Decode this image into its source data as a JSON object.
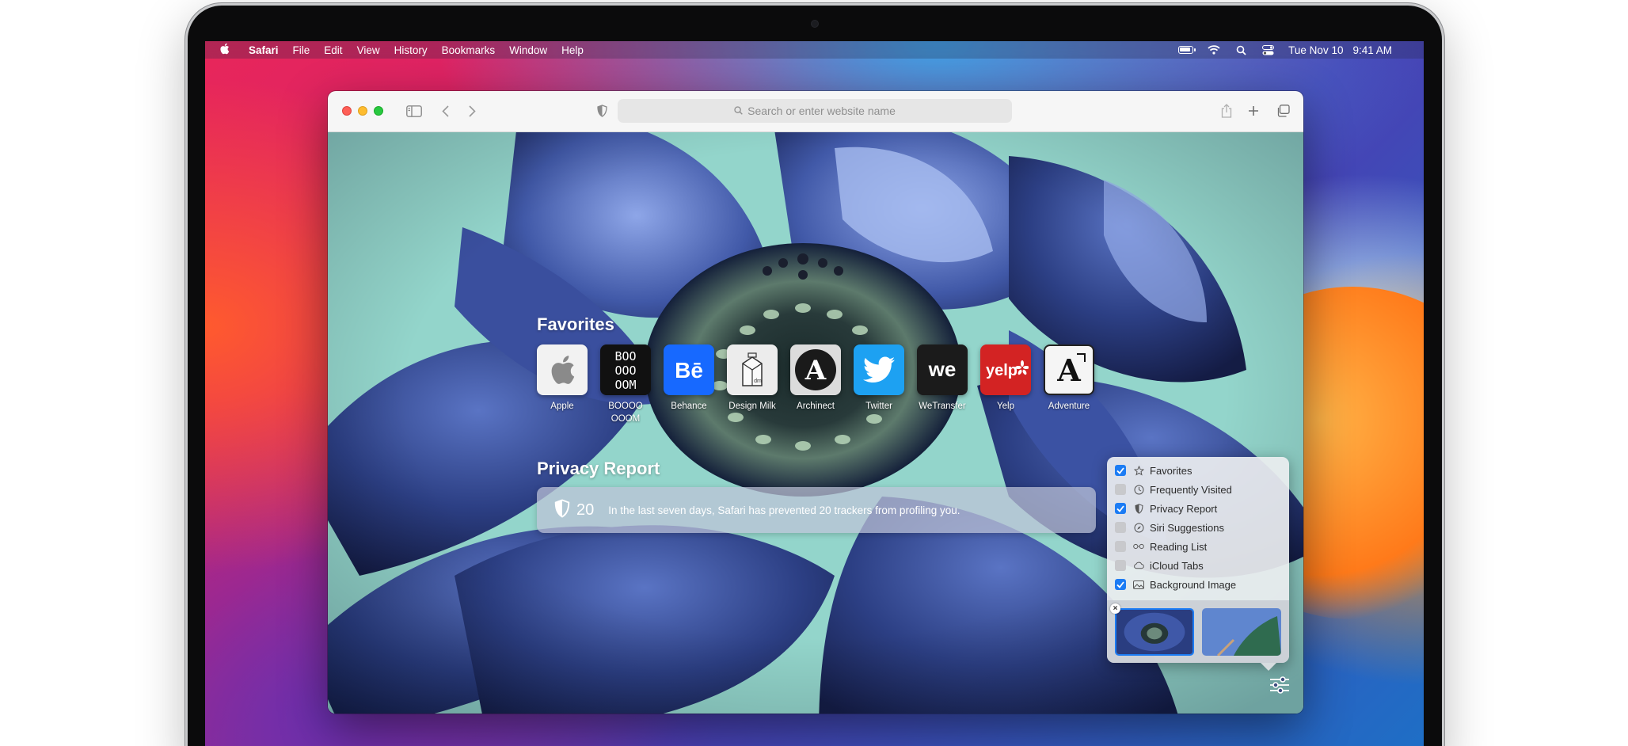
{
  "menubar": {
    "app": "Safari",
    "items": [
      "File",
      "Edit",
      "View",
      "History",
      "Bookmarks",
      "Window",
      "Help"
    ],
    "date": "Tue Nov 10",
    "time": "9:41 AM"
  },
  "toolbar": {
    "address_placeholder": "Search or enter website name"
  },
  "favorites": {
    "title": "Favorites",
    "items": [
      {
        "label": "Apple"
      },
      {
        "label": "BOOOO\nOOOM"
      },
      {
        "label": "Behance"
      },
      {
        "label": "Design Milk"
      },
      {
        "label": "Archinect"
      },
      {
        "label": "Twitter"
      },
      {
        "label": "WeTransfer"
      },
      {
        "label": "Yelp"
      },
      {
        "label": "Adventure"
      }
    ]
  },
  "privacy": {
    "title": "Privacy Report",
    "count": "20",
    "text": "In the last seven days, Safari has prevented 20 trackers from profiling you."
  },
  "customize": {
    "options": [
      {
        "label": "Favorites",
        "checked": true,
        "icon": "star-icon"
      },
      {
        "label": "Frequently Visited",
        "checked": false,
        "icon": "clock-icon"
      },
      {
        "label": "Privacy Report",
        "checked": true,
        "icon": "shield-icon"
      },
      {
        "label": "Siri Suggestions",
        "checked": false,
        "icon": "compass-icon"
      },
      {
        "label": "Reading List",
        "checked": false,
        "icon": "glasses-icon"
      },
      {
        "label": "iCloud Tabs",
        "checked": false,
        "icon": "cloud-icon"
      },
      {
        "label": "Background Image",
        "checked": true,
        "icon": "image-icon"
      }
    ]
  },
  "colors": {
    "accent": "#1c7cf4",
    "behance": "#1769ff",
    "twitter": "#1da1f2",
    "yelp": "#d32323"
  }
}
